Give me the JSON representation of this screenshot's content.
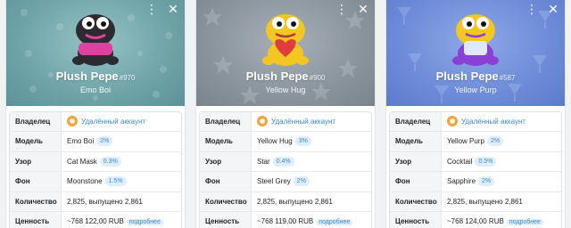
{
  "labels": {
    "owner": "Владелец",
    "model": "Модель",
    "pattern": "Узор",
    "background": "Фон",
    "quantity": "Количество",
    "value": "Ценность"
  },
  "cards": [
    {
      "name": "Plush Pepe",
      "number": "#970",
      "subtitle": "Emo Boi",
      "owner": "Удалённый аккаунт",
      "model": "Emo Boi",
      "model_pct": "2%",
      "pattern": "Cat Mask",
      "pattern_pct": "0.3%",
      "background": "Moonstone",
      "background_pct": "1.5%",
      "quantity": "2,825, выпущено 2,861",
      "value": "~768 122,00 RUB",
      "more": "подробнее",
      "header_color": "#7aaeb3",
      "frog_color": "#2b2b30",
      "accent_color": "#e040a0"
    },
    {
      "name": "Plush Pepe",
      "number": "#900",
      "subtitle": "Yellow Hug",
      "owner": "Удалённый аккаунт",
      "model": "Yellow Hug",
      "model_pct": "3%",
      "pattern": "Star",
      "pattern_pct": "0.4%",
      "background": "Steel Grey",
      "background_pct": "2%",
      "quantity": "2,825, выпущено 2,861",
      "value": "~768 119,00 RUB",
      "more": "подробнее",
      "header_color": "#949ea7",
      "frog_color": "#f3c623",
      "accent_color": "#e23b3b"
    },
    {
      "name": "Plush Pepe",
      "number": "#587",
      "subtitle": "Yellow Purp",
      "owner": "Удалённый аккаунт",
      "model": "Yellow Purp",
      "model_pct": "2%",
      "pattern": "Cocktail",
      "pattern_pct": "0.5%",
      "background": "Sapphire",
      "background_pct": "2%",
      "quantity": "2,825, выпущено 2,861",
      "value": "~768 124,00 RUB",
      "more": "подробнее",
      "header_color": "#7592dc",
      "frog_color": "#f3c623",
      "accent_color": "#8a3fd6"
    }
  ]
}
